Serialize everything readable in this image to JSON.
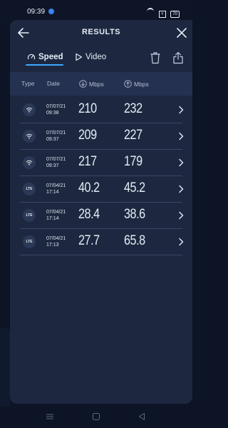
{
  "status": {
    "time": "09:39",
    "battery": "70"
  },
  "header": {
    "title": "RESULTS"
  },
  "tabs": [
    {
      "label": "Speed"
    },
    {
      "label": "Video"
    }
  ],
  "columns": {
    "type": "Type",
    "date": "Date",
    "download": "Mbps",
    "upload": "Mbps"
  },
  "results": [
    {
      "type": "wifi",
      "date": "07/07/21",
      "time": "09:38",
      "download": "210",
      "upload": "232"
    },
    {
      "type": "wifi",
      "date": "07/07/21",
      "time": "09:37",
      "download": "209",
      "upload": "227"
    },
    {
      "type": "wifi",
      "date": "07/07/21",
      "time": "09:37",
      "download": "217",
      "upload": "179"
    },
    {
      "type": "LTE",
      "date": "07/04/21",
      "time": "17:14",
      "download": "40.2",
      "upload": "45.2"
    },
    {
      "type": "LTE",
      "date": "07/04/21",
      "time": "17:14",
      "download": "28.4",
      "upload": "38.6"
    },
    {
      "type": "LTE",
      "date": "07/04/21",
      "time": "17:13",
      "download": "27.7",
      "upload": "65.8"
    }
  ],
  "colors": {
    "accent": "#3ea7ff",
    "sheet": "#1d2840",
    "background": "#0c1425"
  }
}
